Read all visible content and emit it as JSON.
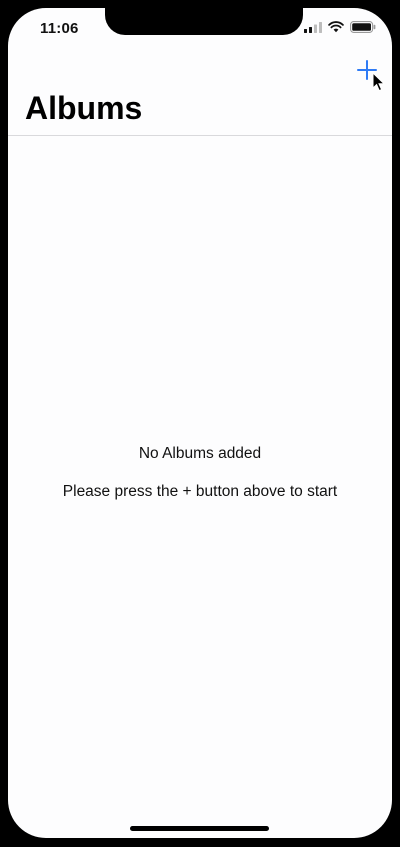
{
  "status_bar": {
    "time": "11:06",
    "icons": [
      "signal-icon",
      "wifi-icon",
      "battery-icon"
    ]
  },
  "nav_bar": {
    "title": "Albums",
    "add_button_icon": "plus-icon",
    "accent_color": "#2f7bf5"
  },
  "empty_state": {
    "title": "No Albums added",
    "message": "Please press the + button above to start"
  }
}
